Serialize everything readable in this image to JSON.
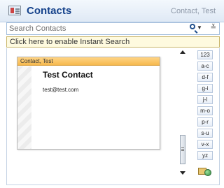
{
  "header": {
    "title": "Contacts",
    "context": "Contact, Test",
    "icon": "contacts-card-icon"
  },
  "search": {
    "placeholder": "Search Contacts",
    "value": "",
    "search_icon": "magnifier-icon",
    "dropdown_icon": "chevron-down-icon",
    "expand_icon": "double-chevron-down-icon"
  },
  "info_bar": {
    "text": "Click here to enable Instant Search"
  },
  "card": {
    "file_as": "Contact, Test",
    "full_name": "Test Contact",
    "email": "test@test.com"
  },
  "alphabet": [
    "123",
    "a-c",
    "d-f",
    "g-i",
    "j-l",
    "m-o",
    "p-r",
    "s-u",
    "v-x",
    "yz"
  ],
  "colors": {
    "title": "#15428b",
    "card_header": "#f6b94e",
    "info_bar_bg": "#fefadf"
  }
}
